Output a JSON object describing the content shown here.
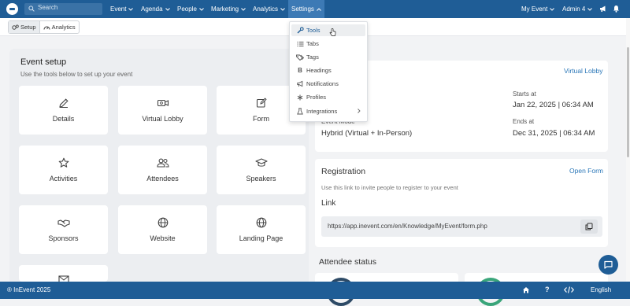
{
  "nav": {
    "search_placeholder": "Search",
    "items": [
      "Event",
      "Agenda",
      "People",
      "Marketing",
      "Analytics",
      "Settings"
    ],
    "my_event": "My Event",
    "admin": "Admin 4"
  },
  "toolbar": {
    "setup": "Setup",
    "analytics": "Analytics"
  },
  "event_setup": {
    "title": "Event setup",
    "subtitle": "Use the tools below to set up your event",
    "tiles": [
      "Details",
      "Virtual Lobby",
      "Form",
      "Activities",
      "Attendees",
      "Speakers",
      "Sponsors",
      "Website",
      "Landing Page"
    ]
  },
  "event_info": {
    "virtual_lobby_link": "Virtual Lobby",
    "starts_label": "Starts at",
    "starts_value": "Jan 22, 2025 | 06:34 AM",
    "mode_label": "Event Mode",
    "mode_value": "Hybrid (Virtual + In-Person)",
    "ends_label": "Ends at",
    "ends_value": "Dec 31, 2025 | 06:34 AM"
  },
  "registration": {
    "title": "Registration",
    "open_form": "Open Form",
    "desc": "Use this link to invite people to register to your event",
    "link_label": "Link",
    "url": "https://app.inevent.com/en/Knowledge/MyEvent/form.php"
  },
  "attendee_status": {
    "title": "Attendee status"
  },
  "settings_menu": {
    "items": [
      "Tools",
      "Tabs",
      "Tags",
      "Headings",
      "Notifications",
      "Profiles",
      "Integrations"
    ],
    "highlighted": "Tools"
  },
  "footer": {
    "copyright": "® InEvent 2025",
    "language": "English"
  },
  "colors": {
    "primary": "#1f5d96",
    "link": "#2b77b8",
    "panel": "#eceef1"
  }
}
